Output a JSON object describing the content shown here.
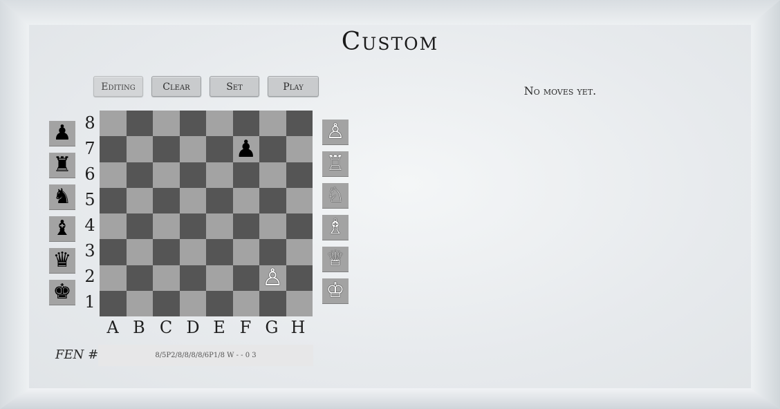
{
  "title": "Custom",
  "buttons": {
    "editing": "Editing",
    "clear": "Clear",
    "set": "Set",
    "play": "Play"
  },
  "moves_text": "No moves yet.",
  "ranks": [
    "8",
    "7",
    "6",
    "5",
    "4",
    "3",
    "2",
    "1"
  ],
  "files": [
    "A",
    "B",
    "C",
    "D",
    "E",
    "F",
    "G",
    "H"
  ],
  "pieces": {
    "black_pawn": "♟",
    "black_rook": "♜",
    "black_knight": "♞",
    "black_bishop": "♝",
    "black_queen": "♛",
    "black_king": "♚",
    "white_pawn": "♙",
    "white_rook": "♖",
    "white_knight": "♘",
    "white_bishop": "♗",
    "white_queen": "♕",
    "white_king": "♔"
  },
  "board_pieces": [
    {
      "square": "F7",
      "piece": "black_pawn"
    },
    {
      "square": "G2",
      "piece": "white_pawn"
    }
  ],
  "fen": {
    "label": "FEN #",
    "value": "8/5P2/8/8/8/8/6P1/8 W - - 0 3"
  },
  "colors": {
    "light_square": "#a3a3a3",
    "dark_square": "#555555"
  }
}
